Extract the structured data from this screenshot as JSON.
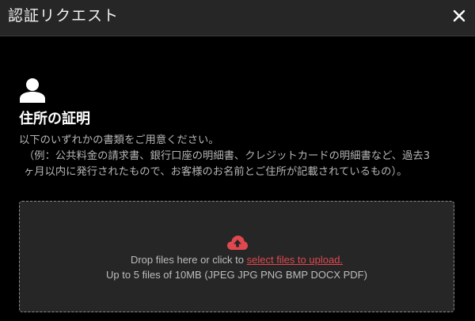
{
  "header": {
    "title": "認証リクエスト",
    "close_icon": "close-icon"
  },
  "section": {
    "icon": "user-icon",
    "title": "住所の証明",
    "desc_line1": "以下のいずれかの書類をご用意ください。",
    "desc_line2": "（例：公共料金の請求書、銀行口座の明細書、クレジットカードの明細書など、過去3",
    "desc_line3": "ヶ月以内に発行されたもので、お客様のお名前とご住所が記載されているもの）。"
  },
  "dropzone": {
    "icon": "cloud-upload-icon",
    "text_prefix": "Drop files here or click to ",
    "link_text": "select files to upload.",
    "limits": "Up to 5 files of 10MB (JPEG JPG PNG BMP DOCX PDF)"
  },
  "colors": {
    "background": "#000000",
    "header_bg": "#262626",
    "dropzone_bg": "#262626",
    "accent": "#e0484f",
    "muted_text": "#b5b5b5"
  }
}
